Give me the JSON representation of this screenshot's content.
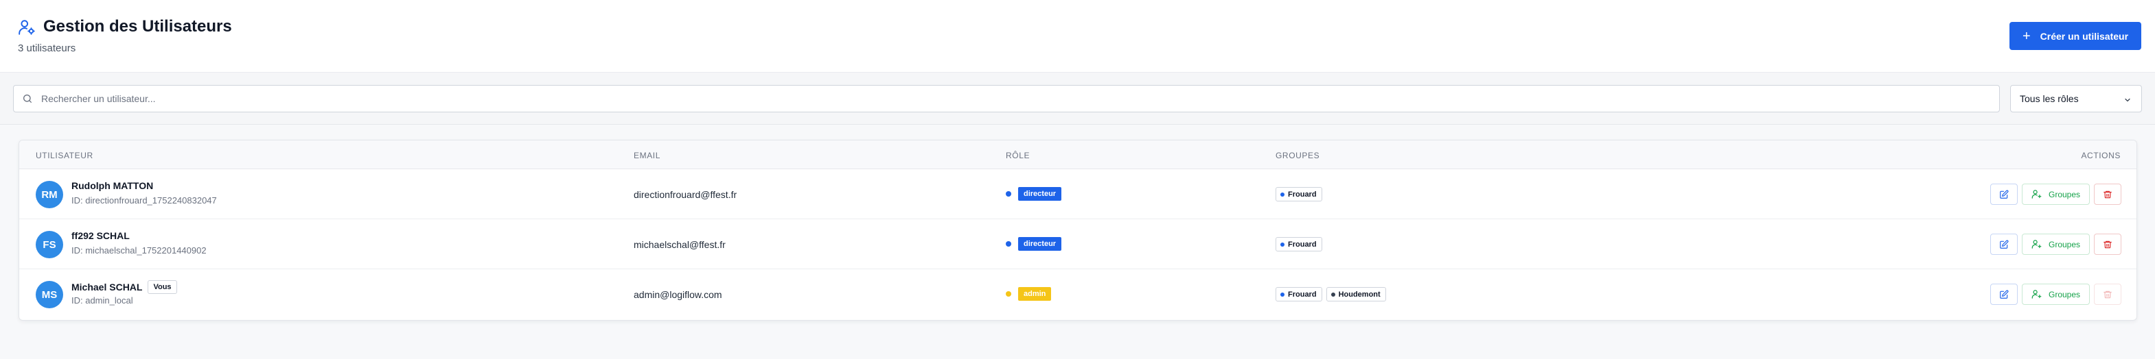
{
  "header": {
    "title": "Gestion des Utilisateurs",
    "subtitle": "3 utilisateurs",
    "create_label": "Créer un utilisateur",
    "accent": "#1e63e9"
  },
  "filters": {
    "search_placeholder": "Rechercher un utilisateur...",
    "role_filter": "Tous les rôles"
  },
  "table": {
    "columns": [
      "Utilisateur",
      "Email",
      "Rôle",
      "Groupes",
      "Actions"
    ],
    "groups_button_label": "Groupes",
    "rows": [
      {
        "initials": "RM",
        "name": "Rudolph MATTON",
        "id": "ID: directionfrouard_1752240832047",
        "email": "directionfrouard@ffest.fr",
        "role": "directeur",
        "role_color": "#1e63e9",
        "groups": [
          {
            "name": "Frouard",
            "color": "#1e63e9"
          }
        ],
        "delete_enabled": true
      },
      {
        "initials": "FS",
        "name": "ff292 SCHAL",
        "id": "ID: michaelschal_1752201440902",
        "email": "michaelschal@ffest.fr",
        "role": "directeur",
        "role_color": "#1e63e9",
        "groups": [
          {
            "name": "Frouard",
            "color": "#1e63e9"
          }
        ],
        "delete_enabled": true
      },
      {
        "initials": "MS",
        "name": "Michael SCHAL",
        "you_badge": "Vous",
        "id": "ID: admin_local",
        "email": "admin@logiflow.com",
        "role": "admin",
        "role_color": "#f5c518",
        "groups": [
          {
            "name": "Frouard",
            "color": "#1e63e9"
          },
          {
            "name": "Houdemont",
            "color": "#374151"
          }
        ],
        "delete_enabled": false
      }
    ]
  }
}
